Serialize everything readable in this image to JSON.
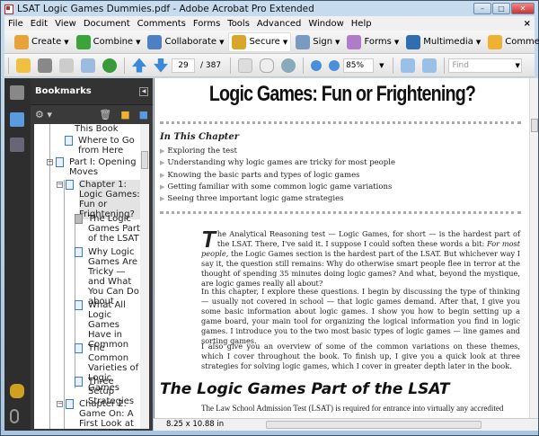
{
  "window": {
    "title": "LSAT Logic Games Dummies.pdf - Adobe Acrobat Pro Extended",
    "minimize": "–",
    "maximize": "□",
    "close": "✕"
  },
  "menu": [
    "File",
    "Edit",
    "View",
    "Document",
    "Comments",
    "Forms",
    "Tools",
    "Advanced",
    "Window",
    "Help"
  ],
  "menu_close": "×",
  "toolbar1": [
    {
      "label": "Create",
      "color": "#e8a23a"
    },
    {
      "label": "Combine",
      "color": "#3aa33a"
    },
    {
      "label": "Collaborate",
      "color": "#4c7fc4"
    },
    {
      "label": "Secure",
      "color": "#d9a52a"
    },
    {
      "label": "Sign",
      "color": "#7a9ac0"
    },
    {
      "label": "Forms",
      "color": "#b07cc8"
    },
    {
      "label": "Multimedia",
      "color": "#2f6fb0"
    },
    {
      "label": "Comment",
      "color": "#f0b030"
    }
  ],
  "toolbar2": {
    "page": "29",
    "page_total": "/ 387",
    "zoom": "85%",
    "find_placeholder": "Find"
  },
  "bookmarks": {
    "title": "Bookmarks",
    "items": [
      {
        "label": "This Book"
      },
      {
        "label": "Where to Go from Here"
      },
      {
        "label": "Part I: Opening Moves"
      },
      {
        "label": "Chapter 1: Logic Games: Fun or Frightening?"
      },
      {
        "label": "The Logic Games Part of the LSAT"
      },
      {
        "label": "Why Logic Games Are Tricky — and What You Can Do about"
      },
      {
        "label": "What All Logic Games Have in Common"
      },
      {
        "label": "The Common Varieties of Logic Games"
      },
      {
        "label": "Three Setup Strategies"
      },
      {
        "label": "Chapter 2: Game On: A First Look at"
      }
    ]
  },
  "document": {
    "title": "Logic Games: Fun or Frightening?",
    "in_this_chapter": "In This Chapter",
    "bullets": [
      "Exploring the test",
      "Understanding why logic games are tricky for most people",
      "Knowing the basic parts and types of logic games",
      "Getting familiar with some common logic game variations",
      "Seeing three important logic game strategies"
    ],
    "drop_cap": "T",
    "p1_a": "he Analytical Reasoning test — Logic Games, for short — is the hardest part of the LSAT. There, I've said it. I suppose I could soften these words a bit: ",
    "p1_em": "For most people",
    "p1_b": ", the Logic Games section is the hardest part of the LSAT. But whichever way I say it, the question still remains: Why do otherwise smart people flee in terror at the thought of spending 35 minutes doing logic games? And what, beyond the mystique, are logic games really all about?",
    "p2": "In this chapter, I explore these questions. I begin by discussing the type of thinking — usually not covered in school — that logic games demand. After that, I give you some basic information about logic games. I show you how to begin setting up a game board, your main tool for organizing the logical information you find in logic games. I introduce you to the two most basic types of logic games — line games and sorting games.",
    "p3": "I also give you an overview of some of the common variations on these themes, which I cover throughout the book. To finish up, I give you a quick look at three strategies for solving logic games, which I cover in greater depth later in the book.",
    "h2": "The Logic Games Part of the LSAT",
    "p4": "The Law School Admission Test (LSAT) is required for entrance into virtually any accredited"
  },
  "status": {
    "page_size": "8.25 x 10.88 in"
  }
}
